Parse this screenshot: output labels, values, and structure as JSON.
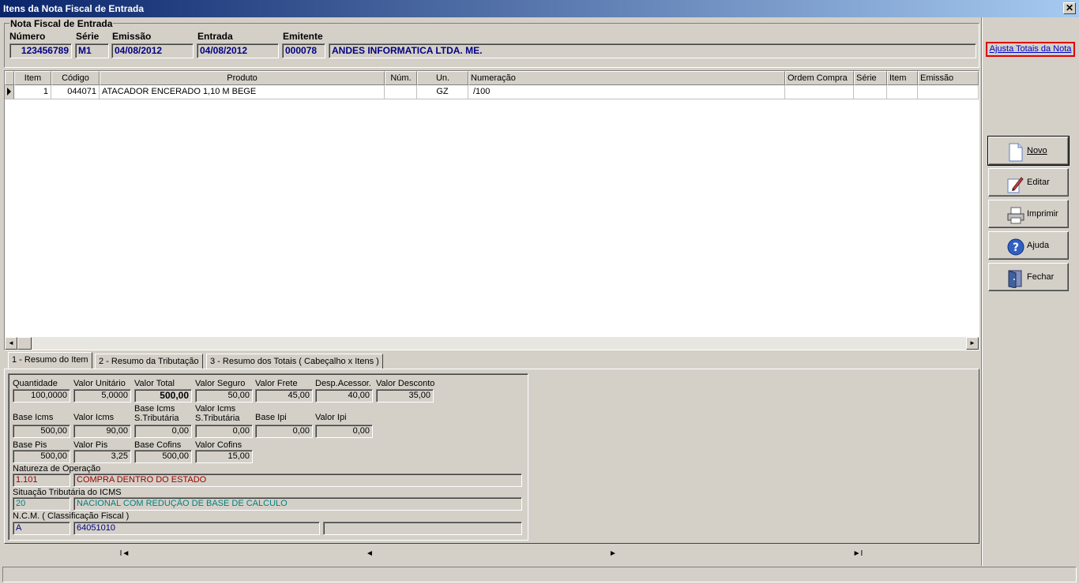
{
  "window": {
    "title": "Itens da Nota Fiscal de Entrada",
    "close": "✕"
  },
  "header": {
    "group_title": "Nota Fiscal de Entrada",
    "labels": {
      "numero": "Número",
      "serie": "Série",
      "emissao": "Emissão",
      "entrada": "Entrada",
      "emitente": "Emitente"
    },
    "values": {
      "numero": "123456789",
      "serie": "M1",
      "emissao": "04/08/2012",
      "entrada": "04/08/2012",
      "emitente_code": "000078",
      "emitente_name": "ANDES INFORMATICA LTDA. ME."
    }
  },
  "link": {
    "ajusta": "Ajusta Totais da Nota"
  },
  "grid": {
    "columns": [
      "Item",
      "Código",
      "Produto",
      "Núm.",
      "Un.",
      "Numeração",
      "Ordem Compra",
      "Série",
      "Item",
      "Emissão"
    ],
    "rows": [
      {
        "item": "1",
        "codigo": "044071",
        "produto": "ATACADOR ENCERADO 1,10 M BEGE",
        "num": "",
        "un": "GZ",
        "numeracao": "/100",
        "ordem": "",
        "serie": "",
        "item2": "",
        "emissao": ""
      }
    ]
  },
  "tabs": [
    "1 - Resumo do Item",
    "2 - Resumo da Tributação",
    "3 - Resumo dos Totais  ( Cabeçalho x Itens )"
  ],
  "resumo": {
    "quantidade": {
      "label": "Quantidade",
      "value": "100,0000"
    },
    "valor_unitario": {
      "label": "Valor Unitário",
      "value": "5,0000"
    },
    "valor_total": {
      "label": "Valor Total",
      "value": "500,00"
    },
    "valor_seguro": {
      "label": "Valor Seguro",
      "value": "50,00"
    },
    "valor_frete": {
      "label": "Valor Frete",
      "value": "45,00"
    },
    "desp_acessor": {
      "label": "Desp.Acessor.",
      "value": "40,00"
    },
    "valor_desconto": {
      "label": "Valor Desconto",
      "value": "35,00"
    },
    "base_icms": {
      "label": "Base Icms",
      "value": "500,00"
    },
    "valor_icms": {
      "label": "Valor Icms",
      "value": "90,00"
    },
    "base_icms_st": {
      "label1": "Base Icms",
      "label2": "S.Tributária",
      "value": "0,00"
    },
    "valor_icms_st": {
      "label1": "Valor Icms",
      "label2": "S.Tributária",
      "value": "0,00"
    },
    "base_ipi": {
      "label": "Base Ipi",
      "value": "0,00"
    },
    "valor_ipi": {
      "label": "Valor Ipi",
      "value": "0,00"
    },
    "base_pis": {
      "label": "Base Pis",
      "value": "500,00"
    },
    "valor_pis": {
      "label": "Valor Pis",
      "value": "3,25"
    },
    "base_cofins": {
      "label": "Base Cofins",
      "value": "500,00"
    },
    "valor_cofins": {
      "label": "Valor Cofins",
      "value": "15,00"
    },
    "natureza": {
      "label": "Natureza de Operação",
      "code": "1.101",
      "desc": "COMPRA DENTRO DO ESTADO"
    },
    "situacao": {
      "label": "Situação Tributária do ICMS",
      "code": "20",
      "desc": "NACIONAL COM REDUÇÃO DE BASE DE CALCULO"
    },
    "ncm": {
      "label": "N.C.M. ( Classificação Fiscal )",
      "code": "A",
      "value": "64051010",
      "extra": ""
    }
  },
  "buttons": {
    "novo": "Novo",
    "editar": "Editar",
    "imprimir": "Imprimir",
    "ajuda": "Ajuda",
    "fechar": "Fechar"
  },
  "nav": {
    "first": "I◄",
    "prev": "◄",
    "next": "►",
    "last": "►I"
  },
  "colors": {
    "title_start": "#0a246a",
    "title_end": "#a6caf0",
    "header_value": "#000080",
    "natureza": "#a00000",
    "situacao": "#008080",
    "ncm": "#000080",
    "link_border": "#e00000"
  }
}
